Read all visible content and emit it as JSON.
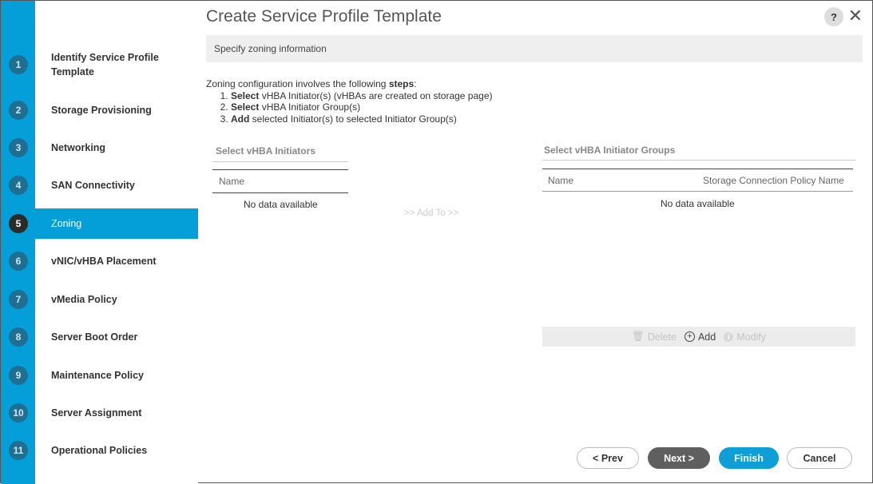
{
  "wizard": {
    "steps": [
      {
        "num": "1",
        "label": "Identify Service Profile Template"
      },
      {
        "num": "2",
        "label": "Storage Provisioning"
      },
      {
        "num": "3",
        "label": "Networking"
      },
      {
        "num": "4",
        "label": "SAN Connectivity"
      },
      {
        "num": "5",
        "label": "Zoning",
        "active": true
      },
      {
        "num": "6",
        "label": "vNIC/vHBA Placement"
      },
      {
        "num": "7",
        "label": "vMedia Policy"
      },
      {
        "num": "8",
        "label": "Server Boot Order"
      },
      {
        "num": "9",
        "label": "Maintenance Policy"
      },
      {
        "num": "10",
        "label": "Server Assignment"
      },
      {
        "num": "11",
        "label": "Operational Policies"
      }
    ]
  },
  "header": {
    "title": "Create Service Profile Template",
    "help_label": "?",
    "close_label": "✕",
    "subtitle": "Specify zoning information"
  },
  "intro": {
    "lead": "Zoning configuration involves the following ",
    "lead_bold": "steps",
    "lead_end": ":",
    "items": [
      {
        "bold": "Select",
        "text": " vHBA Initiator(s) (vHBAs are created on storage page)"
      },
      {
        "bold": "Select",
        "text": " vHBA Initiator Group(s)"
      },
      {
        "bold": "Add",
        "text": " selected Initiator(s) to selected Initiator Group(s)"
      }
    ]
  },
  "initiators": {
    "title": "Select vHBA Initiators",
    "column": "Name",
    "empty": "No data available"
  },
  "add_to_label": ">> Add To >>",
  "groups": {
    "title": "Select vHBA Initiator Groups",
    "columns": [
      "Name",
      "Storage Connection Policy Name"
    ],
    "empty": "No data available",
    "toolbar": {
      "delete": "Delete",
      "add": "Add",
      "modify": "Modify",
      "add_icon": "+",
      "info_icon": "i"
    }
  },
  "footer": {
    "prev": "< Prev",
    "next": "Next >",
    "finish": "Finish",
    "cancel": "Cancel"
  },
  "colors": {
    "accent": "#049fd9",
    "active_step": "#2b2b2b",
    "step_circle": "#1f6f93"
  }
}
